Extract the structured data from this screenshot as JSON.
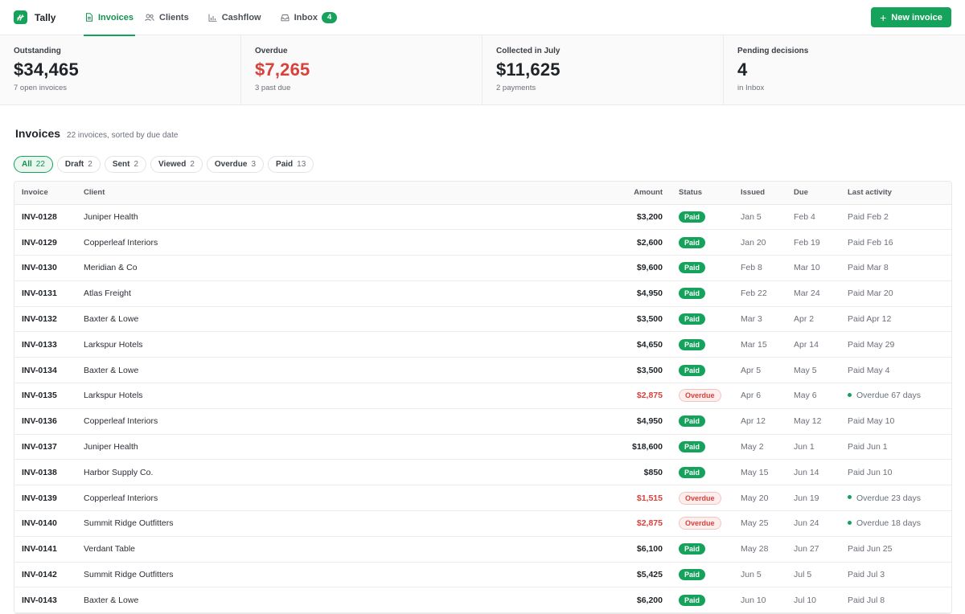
{
  "app": {
    "name": "Tally"
  },
  "nav": {
    "invoices": "Invoices",
    "clients": "Clients",
    "cashflow": "Cashflow",
    "inbox": "Inbox",
    "inbox_count": "4"
  },
  "new_button": "New invoice",
  "stats": [
    {
      "label": "Outstanding",
      "value": "$34,465",
      "sub": "7 open invoices"
    },
    {
      "label": "Overdue",
      "value": "$7,265",
      "sub": "3 past due"
    },
    {
      "label": "Collected in July",
      "value": "$11,625",
      "sub": "2 payments"
    },
    {
      "label": "Pending decisions",
      "value": "4",
      "sub": "in Inbox"
    }
  ],
  "section": {
    "title": "Invoices",
    "subtitle": "22 invoices, sorted by due date"
  },
  "filters": [
    {
      "label": "All",
      "count": "22",
      "active": true
    },
    {
      "label": "Draft",
      "count": "2"
    },
    {
      "label": "Sent",
      "count": "2"
    },
    {
      "label": "Viewed",
      "count": "2"
    },
    {
      "label": "Overdue",
      "count": "3"
    },
    {
      "label": "Paid",
      "count": "13"
    }
  ],
  "columns": {
    "invoice": "Invoice",
    "client": "Client",
    "amount": "Amount",
    "status": "Status",
    "issued": "Issued",
    "due": "Due",
    "activity": "Last activity"
  },
  "rows": [
    {
      "id": "INV-0128",
      "client": "Juniper Health",
      "amount": "$3,200",
      "status": "Paid",
      "issued": "Jan 5",
      "due": "Feb 4",
      "activity": "Paid Feb 2"
    },
    {
      "id": "INV-0129",
      "client": "Copperleaf Interiors",
      "amount": "$2,600",
      "status": "Paid",
      "issued": "Jan 20",
      "due": "Feb 19",
      "activity": "Paid Feb 16"
    },
    {
      "id": "INV-0130",
      "client": "Meridian & Co",
      "amount": "$9,600",
      "status": "Paid",
      "issued": "Feb 8",
      "due": "Mar 10",
      "activity": "Paid Mar 8"
    },
    {
      "id": "INV-0131",
      "client": "Atlas Freight",
      "amount": "$4,950",
      "status": "Paid",
      "issued": "Feb 22",
      "due": "Mar 24",
      "activity": "Paid Mar 20"
    },
    {
      "id": "INV-0132",
      "client": "Baxter & Lowe",
      "amount": "$3,500",
      "status": "Paid",
      "issued": "Mar 3",
      "due": "Apr 2",
      "activity": "Paid Apr 12"
    },
    {
      "id": "INV-0133",
      "client": "Larkspur Hotels",
      "amount": "$4,650",
      "status": "Paid",
      "issued": "Mar 15",
      "due": "Apr 14",
      "activity": "Paid May 29"
    },
    {
      "id": "INV-0134",
      "client": "Baxter & Lowe",
      "amount": "$3,500",
      "status": "Paid",
      "issued": "Apr 5",
      "due": "May 5",
      "activity": "Paid May 4"
    },
    {
      "id": "INV-0135",
      "client": "Larkspur Hotels",
      "amount": "$2,875",
      "status": "Overdue",
      "issued": "Apr 6",
      "due": "May 6",
      "activity": "Overdue 67 days"
    },
    {
      "id": "INV-0136",
      "client": "Copperleaf Interiors",
      "amount": "$4,950",
      "status": "Paid",
      "issued": "Apr 12",
      "due": "May 12",
      "activity": "Paid May 10"
    },
    {
      "id": "INV-0137",
      "client": "Juniper Health",
      "amount": "$18,600",
      "status": "Paid",
      "issued": "May 2",
      "due": "Jun 1",
      "activity": "Paid Jun 1"
    },
    {
      "id": "INV-0138",
      "client": "Harbor Supply Co.",
      "amount": "$850",
      "status": "Paid",
      "issued": "May 15",
      "due": "Jun 14",
      "activity": "Paid Jun 10"
    },
    {
      "id": "INV-0139",
      "client": "Copperleaf Interiors",
      "amount": "$1,515",
      "status": "Overdue",
      "issued": "May 20",
      "due": "Jun 19",
      "activity": "Overdue 23 days"
    },
    {
      "id": "INV-0140",
      "client": "Summit Ridge Outfitters",
      "amount": "$2,875",
      "status": "Overdue",
      "issued": "May 25",
      "due": "Jun 24",
      "activity": "Overdue 18 days"
    },
    {
      "id": "INV-0141",
      "client": "Verdant Table",
      "amount": "$6,100",
      "status": "Paid",
      "issued": "May 28",
      "due": "Jun 27",
      "activity": "Paid Jun 25"
    },
    {
      "id": "INV-0142",
      "client": "Summit Ridge Outfitters",
      "amount": "$5,425",
      "status": "Paid",
      "issued": "Jun 5",
      "due": "Jul 5",
      "activity": "Paid Jul 3"
    },
    {
      "id": "INV-0143",
      "client": "Baxter & Lowe",
      "amount": "$6,200",
      "status": "Paid",
      "issued": "Jun 10",
      "due": "Jul 10",
      "activity": "Paid Jul 8"
    }
  ],
  "colors": {
    "accent": "#15a25b",
    "danger": "#d9413a"
  },
  "icons": {
    "logo": "tally-logo-icon",
    "invoices": "document-icon",
    "clients": "users-icon",
    "cashflow": "bar-chart-icon",
    "inbox": "inbox-tray-icon",
    "new": "plus-icon"
  }
}
